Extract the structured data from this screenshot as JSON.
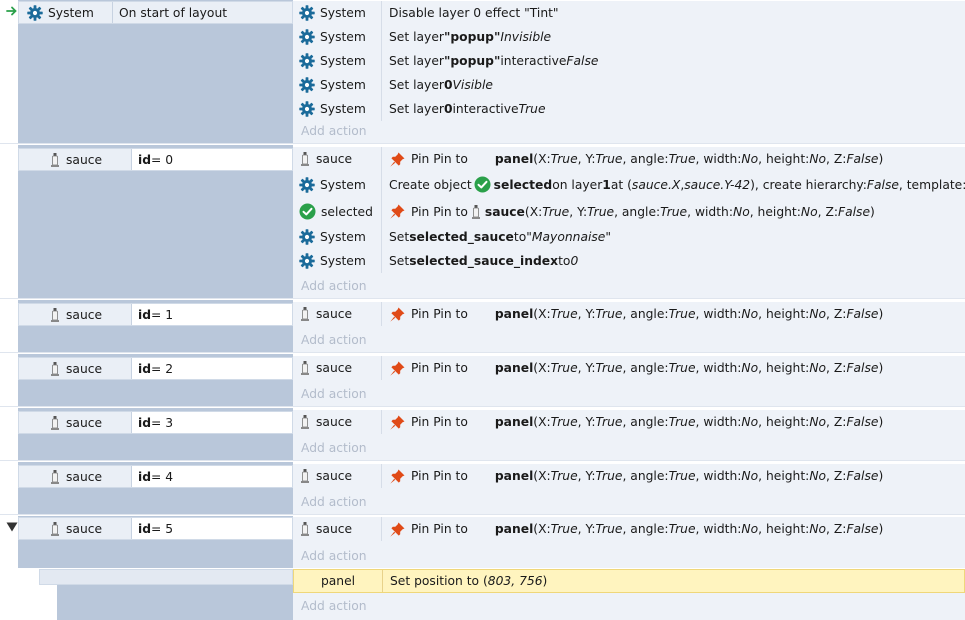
{
  "events": [
    {
      "condition": {
        "object": "System",
        "object_icon": "gear-icon",
        "text": "On start of layout"
      },
      "actions": [
        {
          "object": "System",
          "icon": "gear-icon",
          "parts": [
            [
              "t",
              "Disable layer 0 effect \"Tint\""
            ]
          ]
        },
        {
          "object": "System",
          "icon": "gear-icon",
          "parts": [
            [
              "t",
              "Set layer "
            ],
            [
              "b",
              "\"popup\""
            ],
            [
              "t",
              " "
            ],
            [
              "i",
              "Invisible"
            ]
          ]
        },
        {
          "object": "System",
          "icon": "gear-icon",
          "parts": [
            [
              "t",
              "Set layer "
            ],
            [
              "b",
              "\"popup\""
            ],
            [
              "t",
              " interactive "
            ],
            [
              "i",
              "False"
            ]
          ]
        },
        {
          "object": "System",
          "icon": "gear-icon",
          "parts": [
            [
              "t",
              "Set layer "
            ],
            [
              "b",
              "0"
            ],
            [
              "t",
              " "
            ],
            [
              "i",
              "Visible"
            ]
          ]
        },
        {
          "object": "System",
          "icon": "gear-icon",
          "parts": [
            [
              "t",
              "Set layer "
            ],
            [
              "b",
              "0"
            ],
            [
              "t",
              " interactive "
            ],
            [
              "i",
              "True"
            ]
          ]
        }
      ],
      "add_action": "Add action"
    },
    {
      "condition": {
        "object": "sauce",
        "object_icon": "sauce-sprite-icon",
        "text_parts": [
          [
            "b",
            "id"
          ],
          [
            "t",
            " = 0"
          ]
        ]
      },
      "actions": [
        {
          "object": "sauce",
          "icon": "sauce-sprite-icon",
          "parts": [
            [
              "pin"
            ],
            [
              "t",
              "Pin Pin to"
            ],
            [
              "sp"
            ],
            [
              "b",
              "panel"
            ],
            [
              "t",
              " (X: "
            ],
            [
              "i",
              "True"
            ],
            [
              "t",
              ", Y: "
            ],
            [
              "i",
              "True"
            ],
            [
              "t",
              ", angle: "
            ],
            [
              "i",
              "True"
            ],
            [
              "t",
              ", width: "
            ],
            [
              "i",
              "No"
            ],
            [
              "t",
              ", height: "
            ],
            [
              "i",
              "No"
            ],
            [
              "t",
              ", Z: "
            ],
            [
              "i",
              "False"
            ],
            [
              "t",
              ")"
            ]
          ]
        },
        {
          "object": "System",
          "icon": "gear-icon",
          "parts": [
            [
              "t",
              "Create object "
            ],
            [
              "check"
            ],
            [
              "b",
              "selected"
            ],
            [
              "t",
              " on layer "
            ],
            [
              "b",
              "1"
            ],
            [
              "t",
              " at ("
            ],
            [
              "i",
              "sauce.X"
            ],
            [
              "t",
              ", "
            ],
            [
              "i",
              "sauce.Y-42"
            ],
            [
              "t",
              "), create hierarchy: "
            ],
            [
              "i",
              "False"
            ],
            [
              "t",
              ", template: \"\""
            ]
          ]
        },
        {
          "object": "selected",
          "icon": "check-circle-icon",
          "parts": [
            [
              "pin"
            ],
            [
              "t",
              "Pin Pin to "
            ],
            [
              "sauce"
            ],
            [
              "b",
              "sauce"
            ],
            [
              "t",
              " (X: "
            ],
            [
              "i",
              "True"
            ],
            [
              "t",
              ", Y: "
            ],
            [
              "i",
              "True"
            ],
            [
              "t",
              ", angle: "
            ],
            [
              "i",
              "True"
            ],
            [
              "t",
              ", width: "
            ],
            [
              "i",
              "No"
            ],
            [
              "t",
              ", height: "
            ],
            [
              "i",
              "No"
            ],
            [
              "t",
              ", Z: "
            ],
            [
              "i",
              "False"
            ],
            [
              "t",
              ")"
            ]
          ]
        },
        {
          "object": "System",
          "icon": "gear-icon",
          "parts": [
            [
              "t",
              "Set "
            ],
            [
              "b",
              "selected_sauce"
            ],
            [
              "t",
              " to "
            ],
            [
              "i",
              "\"Mayonnaise\""
            ]
          ]
        },
        {
          "object": "System",
          "icon": "gear-icon",
          "parts": [
            [
              "t",
              "Set "
            ],
            [
              "b",
              "selected_sauce_index"
            ],
            [
              "t",
              " to "
            ],
            [
              "i",
              "0"
            ]
          ]
        }
      ],
      "add_action": "Add action"
    },
    {
      "condition": {
        "object": "sauce",
        "object_icon": "sauce-sprite-icon",
        "text_parts": [
          [
            "b",
            "id"
          ],
          [
            "t",
            " = 1"
          ]
        ]
      },
      "actions": [
        {
          "object": "sauce",
          "icon": "sauce-sprite-icon",
          "parts": [
            [
              "pin"
            ],
            [
              "t",
              "Pin Pin to"
            ],
            [
              "sp"
            ],
            [
              "b",
              "panel"
            ],
            [
              "t",
              " (X: "
            ],
            [
              "i",
              "True"
            ],
            [
              "t",
              ", Y: "
            ],
            [
              "i",
              "True"
            ],
            [
              "t",
              ", angle: "
            ],
            [
              "i",
              "True"
            ],
            [
              "t",
              ", width: "
            ],
            [
              "i",
              "No"
            ],
            [
              "t",
              ", height: "
            ],
            [
              "i",
              "No"
            ],
            [
              "t",
              ", Z: "
            ],
            [
              "i",
              "False"
            ],
            [
              "t",
              ")"
            ]
          ]
        }
      ],
      "add_action": "Add action"
    },
    {
      "condition": {
        "object": "sauce",
        "object_icon": "sauce-sprite-icon",
        "text_parts": [
          [
            "b",
            "id"
          ],
          [
            "t",
            " = 2"
          ]
        ]
      },
      "actions": [
        {
          "object": "sauce",
          "icon": "sauce-sprite-icon",
          "parts": [
            [
              "pin"
            ],
            [
              "t",
              "Pin Pin to"
            ],
            [
              "sp"
            ],
            [
              "b",
              "panel"
            ],
            [
              "t",
              " (X: "
            ],
            [
              "i",
              "True"
            ],
            [
              "t",
              ", Y: "
            ],
            [
              "i",
              "True"
            ],
            [
              "t",
              ", angle: "
            ],
            [
              "i",
              "True"
            ],
            [
              "t",
              ", width: "
            ],
            [
              "i",
              "No"
            ],
            [
              "t",
              ", height: "
            ],
            [
              "i",
              "No"
            ],
            [
              "t",
              ", Z: "
            ],
            [
              "i",
              "False"
            ],
            [
              "t",
              ")"
            ]
          ]
        }
      ],
      "add_action": "Add action"
    },
    {
      "condition": {
        "object": "sauce",
        "object_icon": "sauce-sprite-icon",
        "text_parts": [
          [
            "b",
            "id"
          ],
          [
            "t",
            " = 3"
          ]
        ]
      },
      "actions": [
        {
          "object": "sauce",
          "icon": "sauce-sprite-icon",
          "parts": [
            [
              "pin"
            ],
            [
              "t",
              "Pin Pin to"
            ],
            [
              "sp"
            ],
            [
              "b",
              "panel"
            ],
            [
              "t",
              " (X: "
            ],
            [
              "i",
              "True"
            ],
            [
              "t",
              ", Y: "
            ],
            [
              "i",
              "True"
            ],
            [
              "t",
              ", angle: "
            ],
            [
              "i",
              "True"
            ],
            [
              "t",
              ", width: "
            ],
            [
              "i",
              "No"
            ],
            [
              "t",
              ", height: "
            ],
            [
              "i",
              "No"
            ],
            [
              "t",
              ", Z: "
            ],
            [
              "i",
              "False"
            ],
            [
              "t",
              ")"
            ]
          ]
        }
      ],
      "add_action": "Add action"
    },
    {
      "condition": {
        "object": "sauce",
        "object_icon": "sauce-sprite-icon",
        "text_parts": [
          [
            "b",
            "id"
          ],
          [
            "t",
            " = 4"
          ]
        ]
      },
      "actions": [
        {
          "object": "sauce",
          "icon": "sauce-sprite-icon",
          "parts": [
            [
              "pin"
            ],
            [
              "t",
              "Pin Pin to"
            ],
            [
              "sp"
            ],
            [
              "b",
              "panel"
            ],
            [
              "t",
              " (X: "
            ],
            [
              "i",
              "True"
            ],
            [
              "t",
              ", Y: "
            ],
            [
              "i",
              "True"
            ],
            [
              "t",
              ", angle: "
            ],
            [
              "i",
              "True"
            ],
            [
              "t",
              ", width: "
            ],
            [
              "i",
              "No"
            ],
            [
              "t",
              ", height: "
            ],
            [
              "i",
              "No"
            ],
            [
              "t",
              ", Z: "
            ],
            [
              "i",
              "False"
            ],
            [
              "t",
              ")"
            ]
          ]
        }
      ],
      "add_action": "Add action"
    },
    {
      "condition": {
        "object": "sauce",
        "object_icon": "sauce-sprite-icon",
        "text_parts": [
          [
            "b",
            "id"
          ],
          [
            "t",
            " = 5"
          ]
        ]
      },
      "actions": [
        {
          "object": "sauce",
          "icon": "sauce-sprite-icon",
          "parts": [
            [
              "pin"
            ],
            [
              "t",
              "Pin Pin to"
            ],
            [
              "sp"
            ],
            [
              "b",
              "panel"
            ],
            [
              "t",
              " (X: "
            ],
            [
              "i",
              "True"
            ],
            [
              "t",
              ", Y: "
            ],
            [
              "i",
              "True"
            ],
            [
              "t",
              ", angle: "
            ],
            [
              "i",
              "True"
            ],
            [
              "t",
              ", width: "
            ],
            [
              "i",
              "No"
            ],
            [
              "t",
              ", height: "
            ],
            [
              "i",
              "No"
            ],
            [
              "t",
              ", Z: "
            ],
            [
              "i",
              "False"
            ],
            [
              "t",
              ")"
            ]
          ]
        }
      ],
      "add_action": "Add action"
    }
  ],
  "sub_event": {
    "actions": [
      {
        "object": "panel",
        "parts": [
          [
            "t",
            "Set position to ("
          ],
          [
            "i",
            "803, 756"
          ],
          [
            "t",
            ")"
          ]
        ]
      }
    ],
    "add_action": "Add action"
  },
  "colors": {
    "gear": "#1b6b9a",
    "check": "#2aa04a",
    "pin": "#e04a17",
    "arrow": "#2aa04a",
    "condition_body": "#b9c7da",
    "action_bg": "#eef2f8",
    "highlight_bg": "#fff4bf"
  }
}
